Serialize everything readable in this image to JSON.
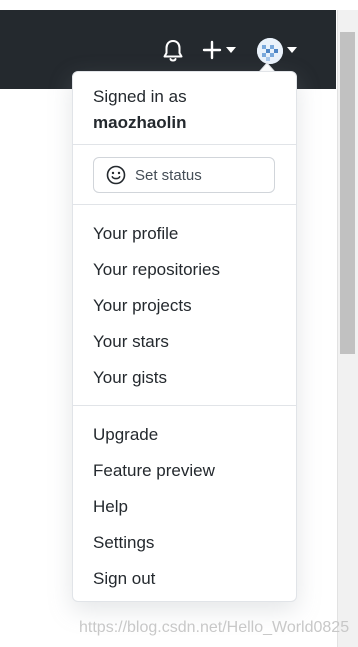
{
  "header": {
    "bell_icon": "bell-icon",
    "create_icon": "plus-icon",
    "avatar_icon": "avatar"
  },
  "menu": {
    "signed_in_label": "Signed in as",
    "username": "maozhaolin",
    "status": {
      "label": "Set status",
      "icon": "smiley-icon"
    },
    "profile_items": [
      {
        "label": "Your profile"
      },
      {
        "label": "Your repositories"
      },
      {
        "label": "Your projects"
      },
      {
        "label": "Your stars"
      },
      {
        "label": "Your gists"
      }
    ],
    "other_items": [
      {
        "label": "Upgrade"
      },
      {
        "label": "Feature preview"
      },
      {
        "label": "Help"
      },
      {
        "label": "Settings"
      },
      {
        "label": "Sign out"
      }
    ]
  },
  "watermark": "https://blog.csdn.net/Hello_World0825",
  "colors": {
    "header_bg": "#24292e",
    "text": "#24292e",
    "border": "#e1e4e8"
  }
}
